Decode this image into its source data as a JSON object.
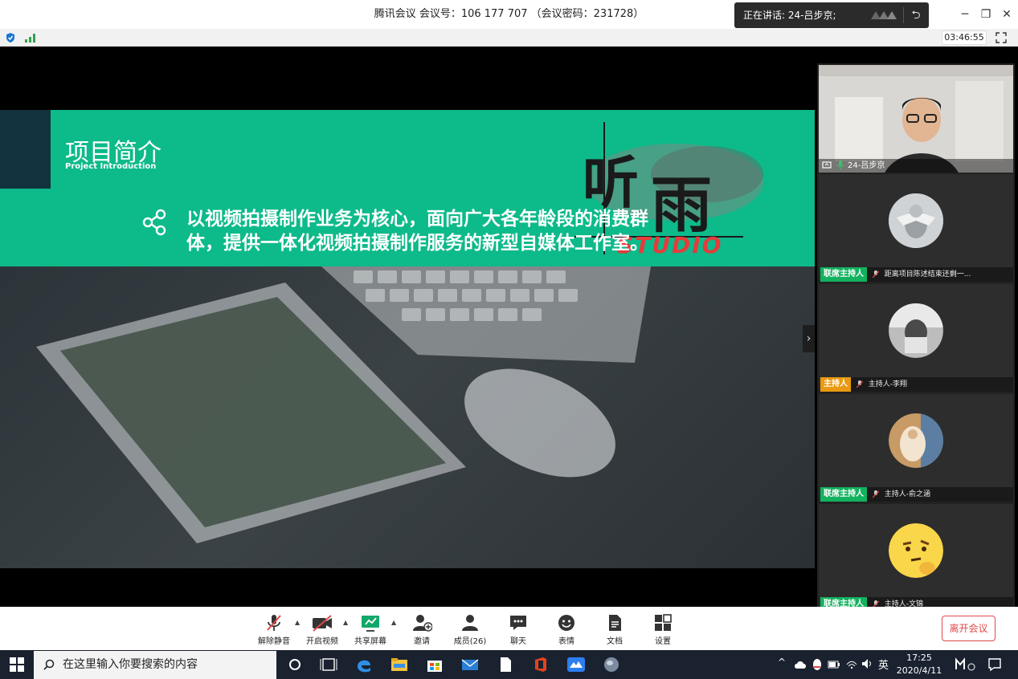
{
  "window": {
    "title": "腾讯会议 会议号：106 177 707 （会议密码：231728）",
    "speaking": "正在讲话: 24-吕步京;",
    "timer": "03:46:55"
  },
  "slide": {
    "title": "项目简介",
    "subtitle": "Project Introduction",
    "logo_text": "听雨",
    "logo_sub": "STUDIO",
    "body": "以视频拍摄制作业务为核心，面向广大各年龄段的消费群体，提供一体化视频拍摄制作服务的新型自媒体工作室。"
  },
  "participants": {
    "video": {
      "name": "24-吕步京"
    },
    "tiles": [
      {
        "role": "联席主持人",
        "role_color": "#13b25f",
        "name": "距离项目陈述结束还剩一..."
      },
      {
        "role": "主持人",
        "role_color": "#e99a10",
        "name": "主持人-李翔"
      },
      {
        "role": "联席主持人",
        "role_color": "#13b25f",
        "name": "主持人-俞之涵"
      },
      {
        "role": "联席主持人",
        "role_color": "#13b25f",
        "name": "主持人-文锦"
      }
    ]
  },
  "toolbar": {
    "mute": "解除静音",
    "video": "开启视频",
    "share": "共享屏幕",
    "invite": "邀请",
    "members": "成员(26)",
    "chat": "聊天",
    "reaction": "表情",
    "docs": "文档",
    "settings": "设置",
    "leave": "离开会议"
  },
  "taskbar": {
    "search_placeholder": "在这里输入你要搜索的内容",
    "ime": "英",
    "time": "17:25",
    "date": "2020/4/11"
  }
}
